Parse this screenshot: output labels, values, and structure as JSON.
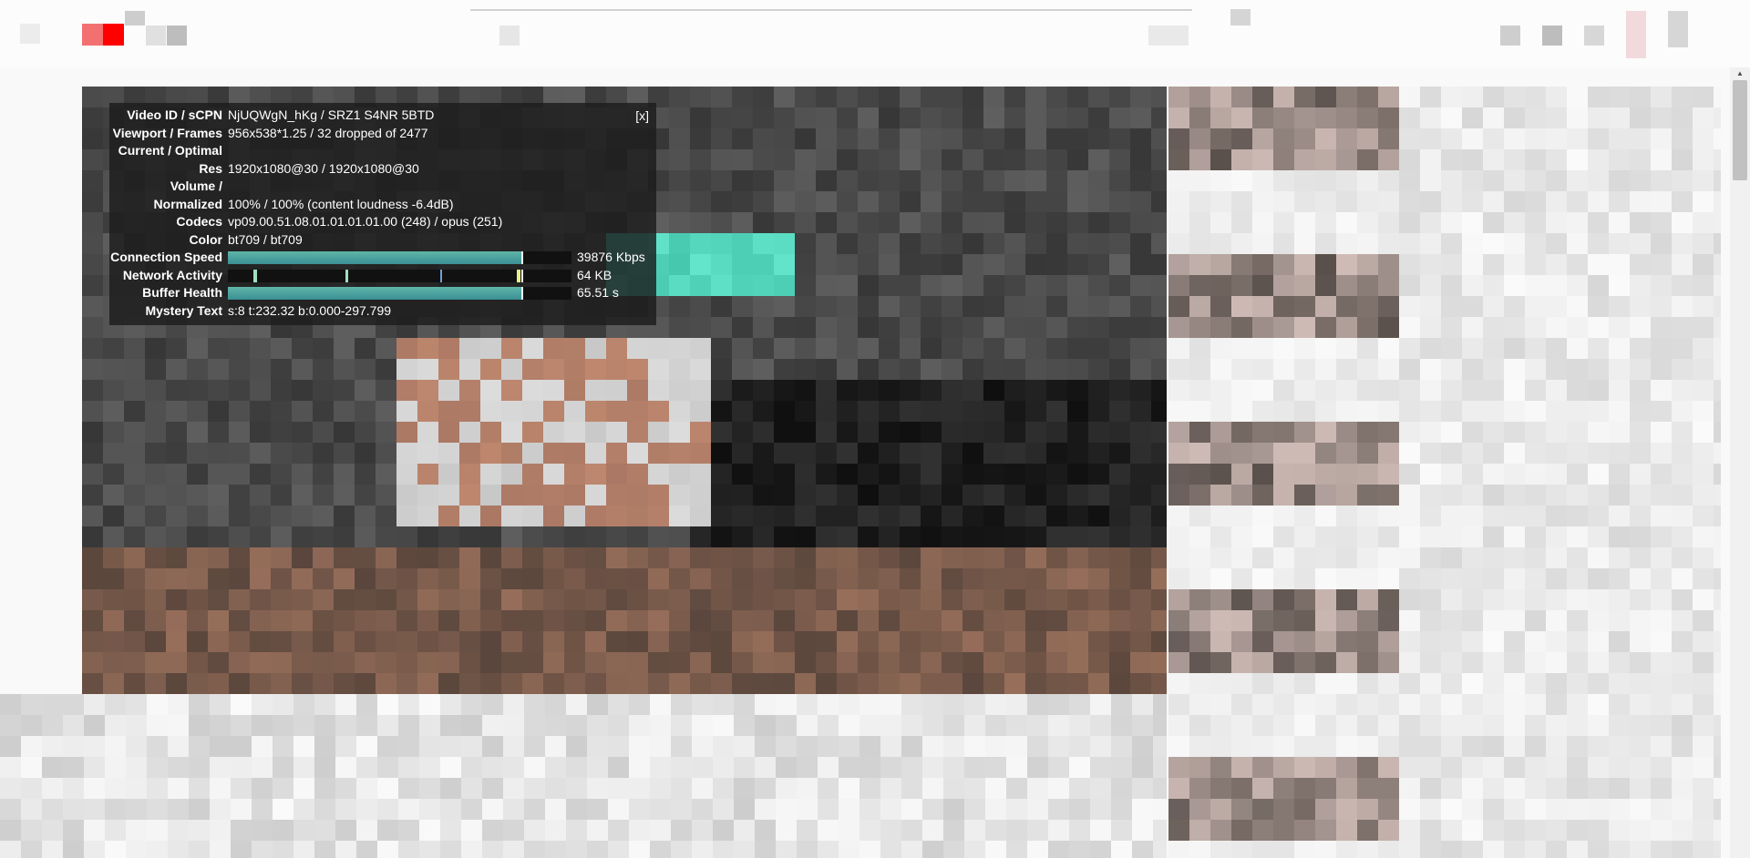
{
  "stats": {
    "close_label": "[x]",
    "rows": [
      {
        "label": "Video ID / sCPN",
        "value": "NjUQWgN_hKg / SRZ1 S4NR 5BTD"
      },
      {
        "label": "Viewport / Frames",
        "value": "956x538*1.25 / 32 dropped of 2477"
      },
      {
        "label": "Current / Optimal",
        "value": ""
      },
      {
        "label": "Res",
        "value": "1920x1080@30 / 1920x1080@30"
      },
      {
        "label": "Volume /",
        "value": ""
      },
      {
        "label": "Normalized",
        "value": "100% / 100% (content loudness -6.4dB)"
      },
      {
        "label": "Codecs",
        "value": "vp09.00.51.08.01.01.01.01.00 (248) / opus (251)"
      },
      {
        "label": "Color",
        "value": "bt709 / bt709"
      }
    ],
    "connection_speed": {
      "label": "Connection Speed",
      "value": "39876 Kbps",
      "fill": 1.0
    },
    "network_activity": {
      "label": "Network Activity",
      "value": "64 KB",
      "fill": 0.0
    },
    "buffer_health": {
      "label": "Buffer Health",
      "value": "65.51 s",
      "fill": 1.0
    },
    "mystery_text": {
      "label": "Mystery Text",
      "value": "s:8 t:232.32 b:0.000-297.799"
    }
  },
  "colors": {
    "overlay_bg": "#1c1c1c",
    "graph_fill": "#4ea6a0",
    "network_tick": "#9fdfbf",
    "network_tick_last": "#e6f08a",
    "logo_red": "#ff0000"
  },
  "icons": {
    "close": "close-icon",
    "logo": "youtube-logo-icon",
    "scroll_up": "scroll-up-icon"
  }
}
